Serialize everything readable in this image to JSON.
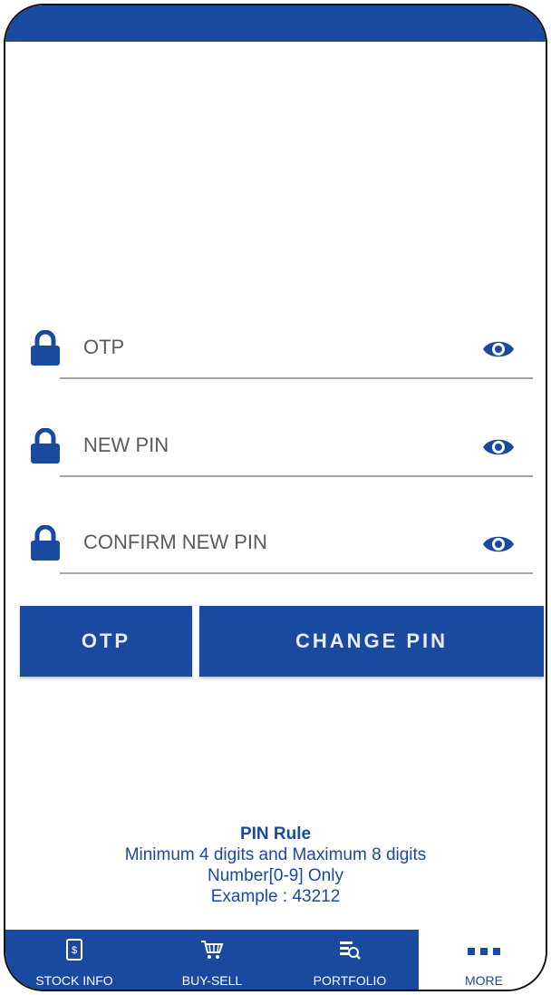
{
  "form": {
    "fields": [
      {
        "label": "OTP"
      },
      {
        "label": "NEW PIN"
      },
      {
        "label": "CONFIRM NEW PIN"
      }
    ],
    "buttons": {
      "otp_label": "OTP",
      "change_pin_label": "CHANGE PIN"
    }
  },
  "pin_rule": {
    "title": "PIN Rule",
    "line1": "Minimum 4 digits and Maximum 8 digits",
    "line2": "Number[0-9] Only",
    "line3": "Example : 43212"
  },
  "tabbar": {
    "items": [
      {
        "label": "STOCK INFO",
        "icon": "phone-dollar-icon"
      },
      {
        "label": "BUY-SELL",
        "icon": "cart-icon"
      },
      {
        "label": "PORTFOLIO",
        "icon": "list-search-icon"
      },
      {
        "label": "MORE",
        "icon": "more-dots-icon"
      }
    ],
    "active_index": 3
  },
  "colors": {
    "primary": "#1a4aa0",
    "label_gray": "#5b5b5b",
    "underline": "#a6a6a6"
  }
}
